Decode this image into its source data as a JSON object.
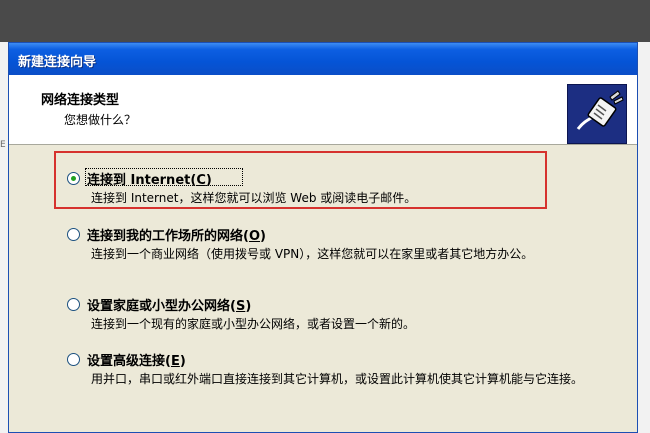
{
  "dialog": {
    "title": "新建连接向导",
    "header_title": "网络连接类型",
    "header_subtitle": "您想做什么？",
    "icon": "network-plug-icon"
  },
  "options": [
    {
      "label_main": "连接到 Internet",
      "shortcut": "C",
      "description": "连接到 Internet，这样您就可以浏览 Web 或阅读电子邮件。",
      "selected": true
    },
    {
      "label_main": "连接到我的工作场所的网络",
      "shortcut": "O",
      "description": "连接到一个商业网络（使用拨号或 VPN），这样您就可以在家里或者其它地方办公。",
      "selected": false
    },
    {
      "label_main": "设置家庭或小型办公网络",
      "shortcut": "S",
      "description": "连接到一个现有的家庭或小型办公网络，或者设置一个新的。",
      "selected": false
    },
    {
      "label_main": "设置高级连接",
      "shortcut": "E",
      "description": "用并口，串口或红外端口直接连接到其它计算机，或设置此计算机使其它计算机能与它连接。",
      "selected": false
    }
  ],
  "backdrop": {
    "edge_char": "E"
  },
  "colors": {
    "titlebar": "#0554d6",
    "dialog_bg": "#ece9d8",
    "highlight": "#d6322e",
    "radio_dot": "#21a121"
  }
}
